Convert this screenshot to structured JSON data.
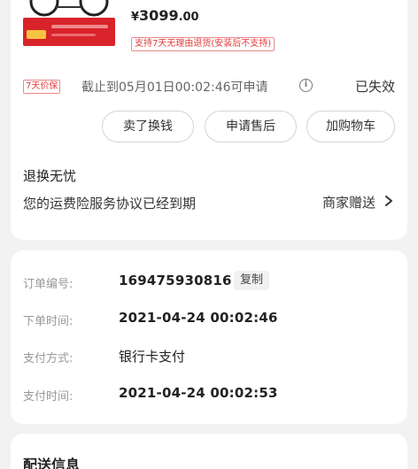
{
  "product": {
    "price_symbol": "¥",
    "price_main": "3099",
    "price_cents": ".00",
    "return_badge": "支持7天无理由退货(安装后不支持)"
  },
  "price_protect": {
    "tag": "7天价保",
    "text": "截止到05月01日00:02:46可申请",
    "info_icon": "ⓘ",
    "status": "已失效"
  },
  "actions": {
    "sell": "卖了换钱",
    "aftersale": "申请售后",
    "add_cart": "加购物车"
  },
  "assurance": {
    "title": "退换无忧",
    "description": "您的运费险服务协议已经到期",
    "merchant_gift": "商家赠送"
  },
  "order": {
    "number_label": "订单编号:",
    "number": "169475930816",
    "copy": "复制",
    "created_label": "下单时间:",
    "created": "2021-04-24 00:02:46",
    "payment_label": "支付方式:",
    "payment": "银行卡支付",
    "paid_label": "支付时间:",
    "paid": "2021-04-24 00:02:53"
  },
  "shipping": {
    "title": "配送信息"
  },
  "colors": {
    "accent_red": "#e23b3b",
    "background": "#f2f2f2"
  }
}
